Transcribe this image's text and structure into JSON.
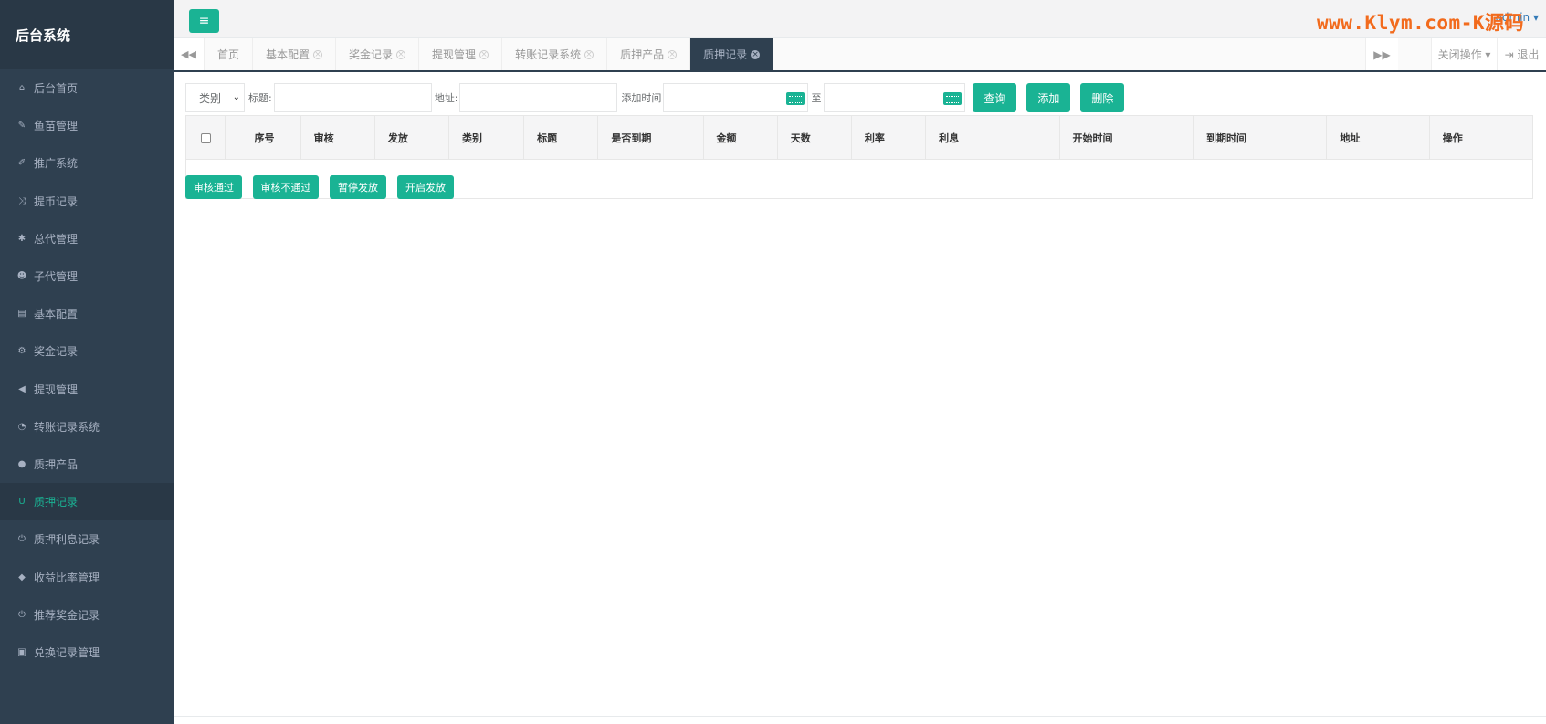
{
  "sidebar": {
    "title": "后台系统",
    "items": [
      {
        "label": "后台首页",
        "icon": "home-icon",
        "glyph": "⌂"
      },
      {
        "label": "鱼苗管理",
        "icon": "wrench-icon",
        "glyph": "✎"
      },
      {
        "label": "推广系统",
        "icon": "edit-icon",
        "glyph": "✐"
      },
      {
        "label": "提币记录",
        "icon": "shuffle-icon",
        "glyph": "⤨"
      },
      {
        "label": "总代管理",
        "icon": "asterisk-icon",
        "glyph": "✱"
      },
      {
        "label": "子代管理",
        "icon": "users-icon",
        "glyph": "☻"
      },
      {
        "label": "基本配置",
        "icon": "file-icon",
        "glyph": "▤"
      },
      {
        "label": "奖金记录",
        "icon": "cogs-icon",
        "glyph": "⚙"
      },
      {
        "label": "提现管理",
        "icon": "bullhorn-icon",
        "glyph": "◀"
      },
      {
        "label": "转账记录系统",
        "icon": "dashboard-icon",
        "glyph": "◔"
      },
      {
        "label": "质押产品",
        "icon": "comment-icon",
        "glyph": "●"
      },
      {
        "label": "质押记录",
        "icon": "magnet-icon",
        "glyph": "U"
      },
      {
        "label": "质押利息记录",
        "icon": "power-icon",
        "glyph": "⏻"
      },
      {
        "label": "收益比率管理",
        "icon": "shield-icon",
        "glyph": "◆"
      },
      {
        "label": "推荐奖金记录",
        "icon": "power-icon",
        "glyph": "⏻"
      },
      {
        "label": "兑换记录管理",
        "icon": "save-icon",
        "glyph": "▣"
      }
    ],
    "active_index": 11
  },
  "topbar": {
    "menu_glyph": "≡",
    "user": "admin ▾",
    "watermark": "www.Klym.com-K源码"
  },
  "tabs": {
    "items": [
      {
        "label": "首页",
        "closable": false
      },
      {
        "label": "基本配置",
        "closable": true
      },
      {
        "label": "奖金记录",
        "closable": true
      },
      {
        "label": "提现管理",
        "closable": true
      },
      {
        "label": "转账记录系统",
        "closable": true
      },
      {
        "label": "质押产品",
        "closable": true
      },
      {
        "label": "质押记录",
        "closable": true
      }
    ],
    "active_index": 6,
    "prev_glyph": "◀◀",
    "next_glyph": "▶▶",
    "close_ops": "关闭操作 ▾",
    "logout": "⇥ 退出"
  },
  "filter": {
    "category_select": "类别",
    "title_label": "标题:",
    "address_label": "地址:",
    "time_label": "添加时间",
    "to_label": "至",
    "search_btn": "查询",
    "add_btn": "添加",
    "delete_btn": "删除"
  },
  "table": {
    "columns": [
      "序号",
      "审核",
      "发放",
      "类别",
      "标题",
      "是否到期",
      "金额",
      "天数",
      "利率",
      "利息",
      "开始时间",
      "到期时间",
      "地址",
      "操作"
    ],
    "rows": []
  },
  "bulk_actions": [
    "审核通过",
    "审核不通过",
    "暂停发放",
    "开启发放"
  ],
  "colors": {
    "accent": "#1ab394",
    "sidebar": "#2f4050",
    "watermark": "#f26b1d"
  }
}
